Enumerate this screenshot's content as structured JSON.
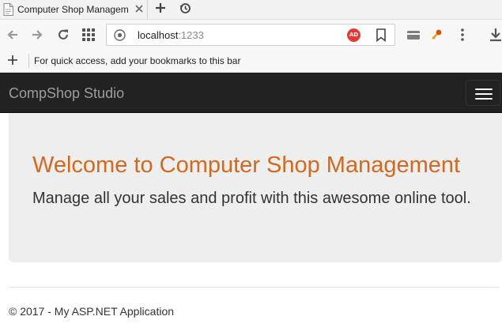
{
  "browser": {
    "tab": {
      "title": "Computer Shop Management",
      "favicon": "page-icon",
      "close": "close-icon"
    },
    "new_tab": "plus-icon",
    "history": "history-icon",
    "nav": {
      "back": "back-arrow-icon",
      "forward": "forward-arrow-icon",
      "refresh": "refresh-icon",
      "apps": "apps-grid-icon"
    },
    "address": {
      "host": "localhost",
      "port": ":1233",
      "ad_badge": "AD"
    },
    "bookmarks_hint": "For quick access, add your bookmarks to this bar",
    "accent": "#e53935"
  },
  "site": {
    "brand": "CompShop Studio",
    "menu_toggle": "hamburger-icon",
    "jumbotron": {
      "title": "Welcome to Computer Shop Management",
      "lead": "Manage all your sales and profit with this awesome online tool."
    },
    "footer": "© 2017 - My ASP.NET Application",
    "colors": {
      "navbar": "#222222",
      "title": "#d2691e",
      "jumbotron_bg": "#eeeeee"
    }
  }
}
